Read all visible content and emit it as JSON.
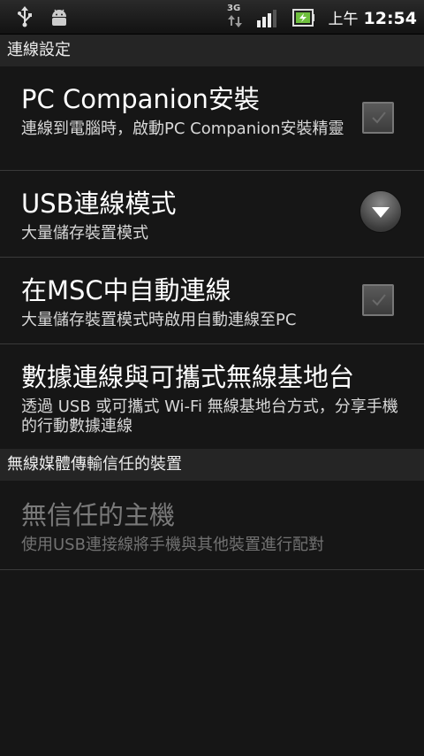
{
  "status_bar": {
    "network": "3G",
    "ampm": "上午",
    "time": "12:54"
  },
  "sections": {
    "connectivity_header": "連線設定",
    "wireless_media_header": "無線媒體傳輸信任的裝置"
  },
  "items": {
    "pc_companion": {
      "title": "PC Companion安裝",
      "summary": "連線到電腦時，啟動PC Companion安裝精靈",
      "checked": false
    },
    "usb_mode": {
      "title": "USB連線模式",
      "summary": "大量儲存裝置模式"
    },
    "msc_auto": {
      "title": "在MSC中自動連線",
      "summary": "大量儲存裝置模式時啟用自動連線至PC",
      "checked": false
    },
    "tethering": {
      "title": "數據連線與可攜式無線基地台",
      "summary": "透過 USB 或可攜式 Wi-Fi 無線基地台方式，分享手機的行動數據連線"
    },
    "untrust_host": {
      "title": "無信任的主機",
      "summary": "使用USB連接線將手機與其他裝置進行配對",
      "enabled": false
    }
  },
  "icons": {
    "usb": "usb-icon",
    "android": "android-debug-icon",
    "network": "3g-icon",
    "signal": "signal-icon",
    "battery": "battery-charging-icon"
  },
  "colors": {
    "background": "#161616",
    "section_header": "#252525",
    "divider": "#3a3a3a",
    "disabled_text": "#7a7a7a"
  }
}
